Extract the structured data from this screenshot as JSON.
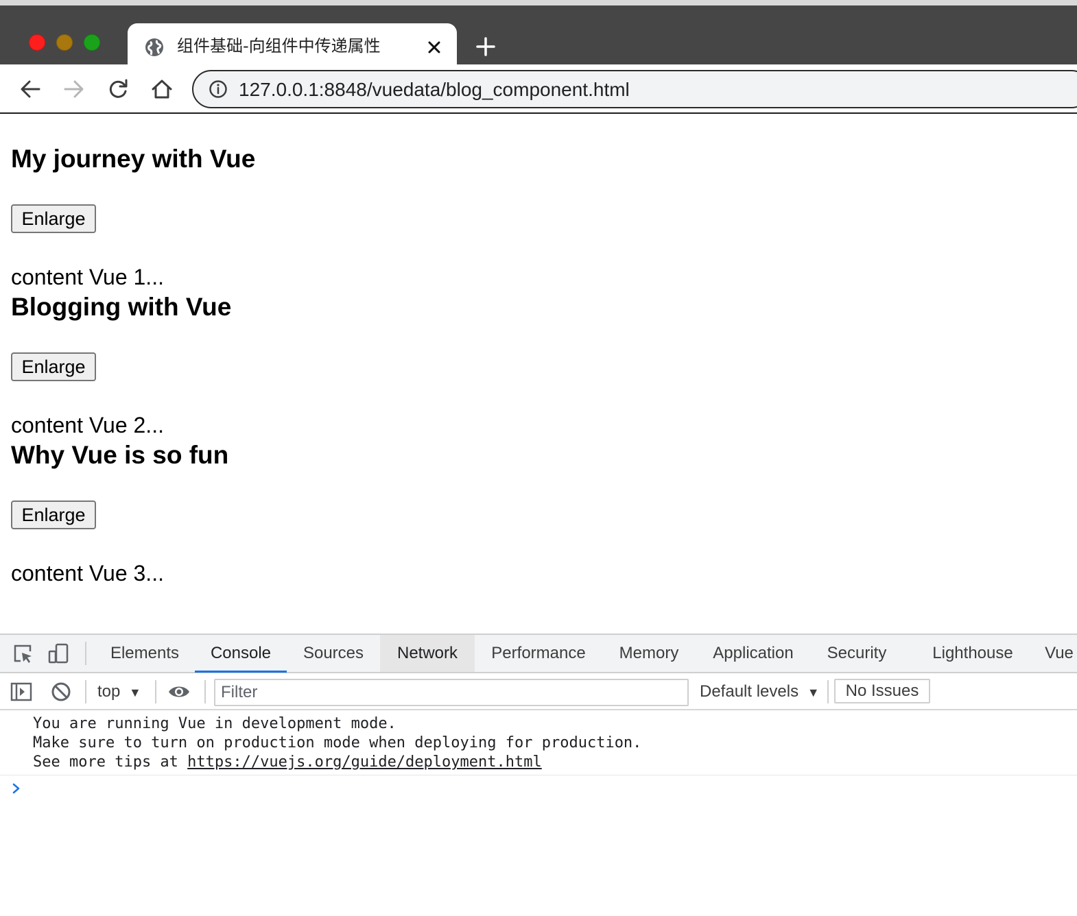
{
  "window": {
    "tab_title": "组件基础-向组件中传递属性",
    "icons": {
      "close_window": "red-dot",
      "minimize": "yellow-dot",
      "maximize": "green-dot",
      "tab_favicon": "globe-icon",
      "tab_close": "close-icon",
      "new_tab": "plus-icon"
    }
  },
  "toolbar": {
    "url": "127.0.0.1:8848/vuedata/blog_component.html",
    "icons": [
      "back-arrow-icon",
      "forward-arrow-icon",
      "reload-icon",
      "home-icon",
      "info-icon"
    ]
  },
  "page": {
    "posts": [
      {
        "title": "My journey with Vue",
        "button_label": "Enlarge",
        "content": "content Vue 1..."
      },
      {
        "title": "Blogging with Vue",
        "button_label": "Enlarge",
        "content": "content Vue 2..."
      },
      {
        "title": "Why Vue is so fun",
        "button_label": "Enlarge",
        "content": "content Vue 3..."
      }
    ]
  },
  "devtools": {
    "tabs": [
      "Elements",
      "Console",
      "Sources",
      "Network",
      "Performance",
      "Memory",
      "Application",
      "Security",
      "Lighthouse",
      "Vue"
    ],
    "active_tab": "Console",
    "hovered_tab": "Network",
    "context": "top",
    "filter_placeholder": "Filter",
    "levels_label": "Default levels",
    "issues_label": "No Issues",
    "console_lines": [
      "You are running Vue in development mode.",
      "Make sure to turn on production mode when deploying for production.",
      "See more tips at "
    ],
    "console_link": "https://vuejs.org/guide/deployment.html",
    "accent_color": "#1a73e8"
  }
}
